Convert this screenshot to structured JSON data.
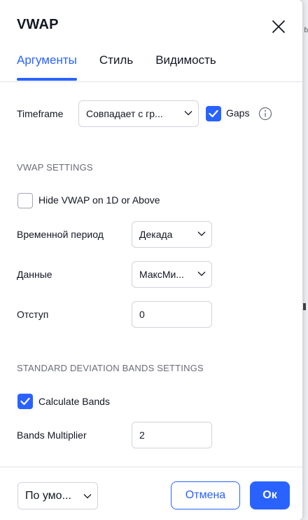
{
  "dialog": {
    "title": "VWAP"
  },
  "tabs": [
    {
      "label": "Аргументы",
      "active": true
    },
    {
      "label": "Стиль",
      "active": false
    },
    {
      "label": "Видимость",
      "active": false
    }
  ],
  "timeframe": {
    "label": "Timeframe",
    "value": "Совпадает с гр...",
    "gaps_label": "Gaps",
    "gaps_checked": true
  },
  "vwap_settings": {
    "section_title": "VWAP SETTINGS",
    "hide_label": "Hide VWAP on 1D or Above",
    "hide_checked": false,
    "period_label": "Временной период",
    "period_value": "Декада",
    "source_label": "Данные",
    "source_value": "МаксМи...",
    "offset_label": "Отступ",
    "offset_value": "0"
  },
  "bands": {
    "section_title": "STANDARD DEVIATION BANDS SETTINGS",
    "calc_label": "Calculate Bands",
    "calc_checked": true,
    "multiplier_label": "Bands Multiplier",
    "multiplier_value": "2"
  },
  "footer": {
    "defaults_label": "По умо...",
    "cancel_label": "Отмена",
    "ok_label": "Ок"
  },
  "colors": {
    "accent": "#2962ff",
    "text": "#131722",
    "muted": "#6a6d78",
    "border": "#d1d4dc"
  }
}
